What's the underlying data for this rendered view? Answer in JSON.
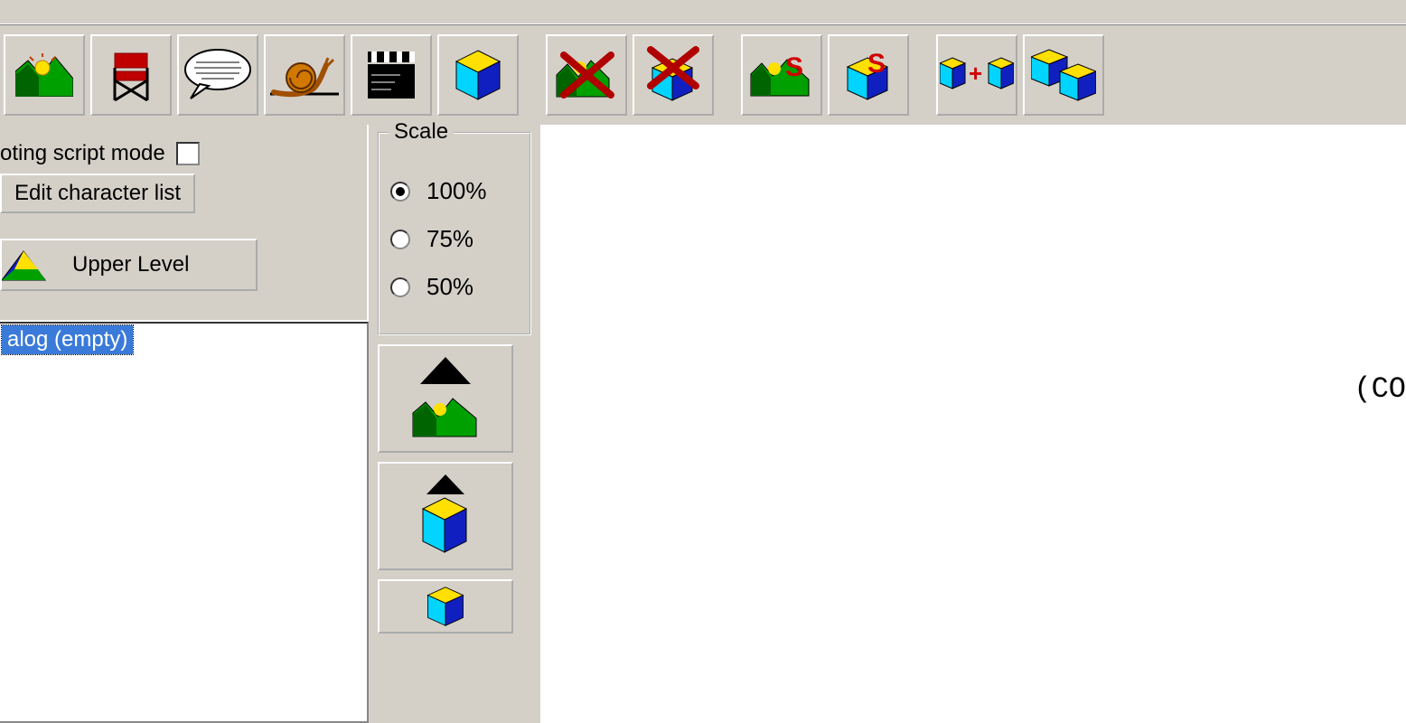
{
  "toolbar": {
    "items": [
      {
        "name": "scene-button",
        "icon": "scene"
      },
      {
        "name": "director-chair-button",
        "icon": "director-chair"
      },
      {
        "name": "dialog-bubble-button",
        "icon": "speech-bubble"
      },
      {
        "name": "snail-button",
        "icon": "snail"
      },
      {
        "name": "clapper-button",
        "icon": "clapper"
      },
      {
        "name": "shot-cube-button",
        "icon": "cube"
      },
      {
        "name": "delete-scene-button",
        "icon": "scene-x"
      },
      {
        "name": "delete-shot-button",
        "icon": "cube-x"
      },
      {
        "name": "save-scene-button",
        "icon": "scene-s"
      },
      {
        "name": "save-shot-button",
        "icon": "cube-s"
      },
      {
        "name": "merge-cubes-button",
        "icon": "cube-plus-cube"
      },
      {
        "name": "split-cube-button",
        "icon": "cube-split"
      }
    ],
    "group_breaks_after": [
      5,
      7,
      9
    ]
  },
  "left": {
    "script_mode_label": "oting script mode",
    "edit_char_label": "Edit character list",
    "upper_level_label": "Upper Level",
    "tree_selected_label": "alog (empty)"
  },
  "scale": {
    "title": "Scale",
    "options": [
      "100%",
      "75%",
      "50%"
    ],
    "selected_index": 0
  },
  "nav": {
    "items": [
      {
        "name": "nav-scene-up-button",
        "icon": "scene-up"
      },
      {
        "name": "nav-cube-up-button",
        "icon": "cube-up"
      },
      {
        "name": "nav-cube-button",
        "icon": "cube-only"
      }
    ]
  },
  "document": {
    "visible_text": "(CO"
  },
  "icons": {
    "scene": "scene-icon",
    "director-chair": "director-chair-icon",
    "speech-bubble": "speech-bubble-icon",
    "snail": "snail-icon",
    "clapper": "clapper-icon",
    "cube": "cube-icon",
    "scene-x": "scene-delete-icon",
    "cube-x": "cube-delete-icon",
    "scene-s": "scene-save-icon",
    "cube-s": "cube-save-icon",
    "cube-plus-cube": "cube-merge-icon",
    "cube-split": "cube-split-icon",
    "scene-up": "scene-up-icon",
    "cube-up": "cube-up-icon",
    "cube-only": "cube-icon",
    "upper-level": "upper-level-icon"
  }
}
